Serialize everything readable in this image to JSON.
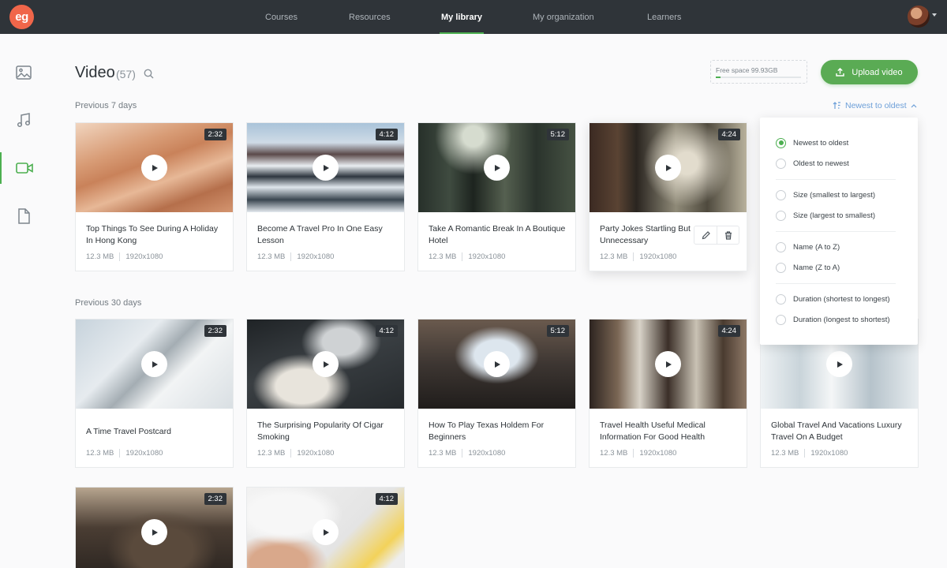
{
  "topbar": {
    "logo_text": "eg",
    "nav": [
      {
        "label": "Courses"
      },
      {
        "label": "Resources"
      },
      {
        "label": "My library",
        "active": true
      },
      {
        "label": "My organization"
      },
      {
        "label": "Learners"
      }
    ]
  },
  "sidebar": {
    "items": [
      {
        "icon": "image-icon"
      },
      {
        "icon": "music-icon"
      },
      {
        "icon": "video-icon",
        "active": true
      },
      {
        "icon": "document-icon"
      }
    ]
  },
  "header": {
    "title": "Video",
    "count": "(57)",
    "free_space": "Free space 99.93GB",
    "free_space_used_fraction": 0.06,
    "upload_label": "Upload video"
  },
  "sections": {
    "recent": "Previous 7 days",
    "month": "Previous 30 days"
  },
  "sort": {
    "label": "Newest to oldest",
    "options": [
      {
        "label": "Newest to oldest",
        "selected": true
      },
      {
        "label": "Oldest to newest"
      },
      {
        "label": "Size (smallest to largest)"
      },
      {
        "label": "Size (largest to smallest)"
      },
      {
        "label": "Name (A to Z)"
      },
      {
        "label": "Name (Z to A)"
      },
      {
        "label": "Duration (shortest to longest)"
      },
      {
        "label": "Duration (longest to shortest)"
      }
    ]
  },
  "videos": [
    {
      "title": "Top Things To See During A Holiday In Hong Kong",
      "duration": "2:32",
      "size": "12.3 MB",
      "resolution": "1920x1080"
    },
    {
      "title": "Become A Travel Pro In One Easy Lesson",
      "duration": "4:12",
      "size": "12.3 MB",
      "resolution": "1920x1080"
    },
    {
      "title": "Take A Romantic Break In A Boutique Hotel",
      "duration": "5:12",
      "size": "12.3 MB",
      "resolution": "1920x1080"
    },
    {
      "title": "Party Jokes Startling But Unnecessary",
      "duration": "4:24",
      "size": "12.3 MB",
      "resolution": "1920x1080"
    },
    {
      "title": "A Time Travel Postcard",
      "duration": "2:32",
      "size": "12.3 MB",
      "resolution": "1920x1080"
    },
    {
      "title": "The Surprising Popularity Of Cigar Smoking",
      "duration": "4:12",
      "size": "12.3 MB",
      "resolution": "1920x1080"
    },
    {
      "title": "How To Play Texas Holdem For Beginners",
      "duration": "5:12",
      "size": "12.3 MB",
      "resolution": "1920x1080"
    },
    {
      "title": "Travel Health Useful Medical Information For Good Health",
      "duration": "4:24",
      "size": "12.3 MB",
      "resolution": "1920x1080"
    },
    {
      "title": "Global Travel And Vacations Luxury Travel On A Budget",
      "duration": "",
      "size": "12.3 MB",
      "resolution": "1920x1080"
    },
    {
      "duration": "2:32"
    },
    {
      "duration": "4:12"
    }
  ],
  "colors": {
    "accent": "#4caf50",
    "topbar": "#2f3439",
    "link": "#6c9fd8",
    "logo": "#f0664a"
  }
}
